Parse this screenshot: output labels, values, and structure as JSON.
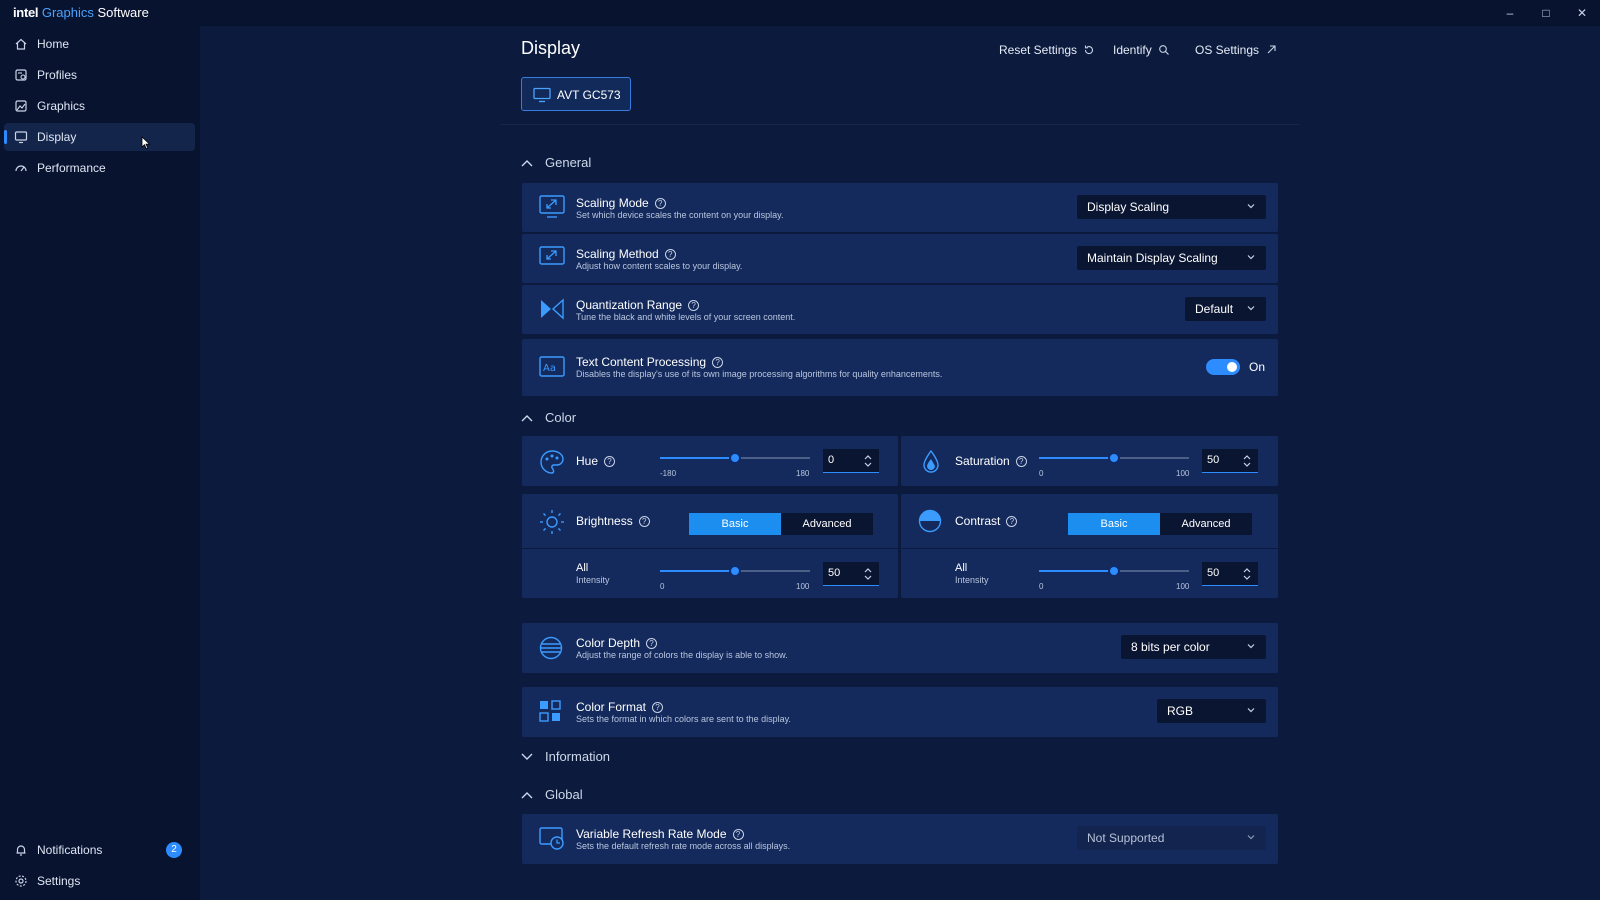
{
  "app": {
    "brand_intel": "intel",
    "brand_graphics": "Graphics",
    "brand_software": "Software"
  },
  "window_controls": [
    "–",
    "□",
    "✕"
  ],
  "sidebar": {
    "items": [
      {
        "label": "Home",
        "icon": "home-icon"
      },
      {
        "label": "Profiles",
        "icon": "profiles-icon"
      },
      {
        "label": "Graphics",
        "icon": "graphics-icon"
      },
      {
        "label": "Display",
        "icon": "display-icon",
        "active": true
      },
      {
        "label": "Performance",
        "icon": "performance-icon"
      }
    ],
    "notifications": {
      "label": "Notifications",
      "count": "2"
    },
    "settings": {
      "label": "Settings"
    }
  },
  "header": {
    "title": "Display",
    "reset": "Reset Settings",
    "identify": "Identify",
    "os_settings": "OS Settings",
    "monitor": "AVT GC573"
  },
  "general": {
    "label": "General",
    "scaling_mode": {
      "title": "Scaling Mode",
      "desc": "Set which device scales the content on your display.",
      "value": "Display Scaling"
    },
    "scaling_method": {
      "title": "Scaling Method",
      "desc": "Adjust how content scales to your display.",
      "value": "Maintain Display Scaling"
    },
    "quantization": {
      "title": "Quantization Range",
      "desc": "Tune the black and white levels of your screen content.",
      "value": "Default"
    },
    "text_processing": {
      "title": "Text Content Processing",
      "desc": "Disables the display's use of its own image processing algorithms for quality enhancements.",
      "state": "On"
    }
  },
  "color": {
    "label": "Color",
    "hue": {
      "title": "Hue",
      "min": "-180",
      "max": "180",
      "value": "0",
      "fraction": 0.5
    },
    "saturation": {
      "title": "Saturation",
      "min": "0",
      "max": "100",
      "value": "50",
      "fraction": 0.5
    },
    "brightness": {
      "title": "Brightness",
      "basic": "Basic",
      "advanced": "Advanced",
      "sub_title": "All",
      "sub_desc": "Intensity",
      "min": "0",
      "max": "100",
      "value": "50",
      "fraction": 0.5
    },
    "contrast": {
      "title": "Contrast",
      "basic": "Basic",
      "advanced": "Advanced",
      "sub_title": "All",
      "sub_desc": "Intensity",
      "min": "0",
      "max": "100",
      "value": "50",
      "fraction": 0.5
    },
    "depth": {
      "title": "Color Depth",
      "desc": "Adjust the range of colors the display is able to show.",
      "value": "8 bits per color"
    },
    "format": {
      "title": "Color Format",
      "desc": "Sets the format in which colors are sent to the display.",
      "value": "RGB"
    }
  },
  "information": {
    "label": "Information"
  },
  "global": {
    "label": "Global",
    "vrr": {
      "title": "Variable Refresh Rate Mode",
      "desc": "Sets the default refresh rate mode across all displays.",
      "value": "Not Supported"
    }
  },
  "colors": {
    "accent": "#2d8cff",
    "card": "#142a5c",
    "background": "#0b1a3d"
  }
}
